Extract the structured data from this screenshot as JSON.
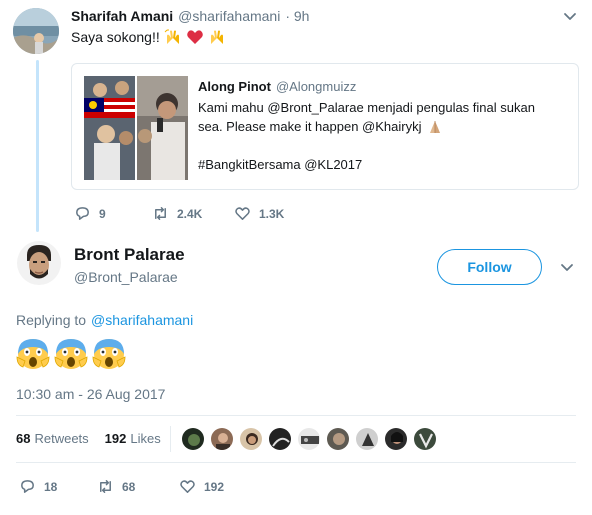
{
  "parent_tweet": {
    "name": "Sharifah Amani",
    "handle": "@sharifahamani",
    "time": "· 9h",
    "text": "Saya sokong!!",
    "emoji_note": "raised-hands, red-heart, raised-hands",
    "quoted": {
      "name": "Along Pinot",
      "handle": "@Alongmuizz",
      "line1": "Kami mahu @Bront_Palarae menjadi pengulas final sukan",
      "line2": "sea. Please make it happen @Khairykj",
      "line3": "#BangkitBersama @KL2017"
    },
    "actions": {
      "replies": "9",
      "retweets": "2.4K",
      "likes": "1.3K"
    }
  },
  "main_tweet": {
    "name": "Bront Palarae",
    "handle": "@Bront_Palarae",
    "follow_label": "Follow",
    "replying_prefix": "Replying to",
    "replying_to": "@sharifahamani",
    "timestamp": "10:30 am - 26 Aug 2017",
    "stats": {
      "retweets_count": "68",
      "retweets_label": "Retweets",
      "likes_count": "192",
      "likes_label": "Likes"
    },
    "actions": {
      "replies": "18",
      "retweets": "68",
      "likes": "192"
    }
  },
  "colors": {
    "accent": "#1b95e0",
    "muted": "#657786",
    "thread_line": "#c4e4fb",
    "like_heart": "#e0245e"
  }
}
